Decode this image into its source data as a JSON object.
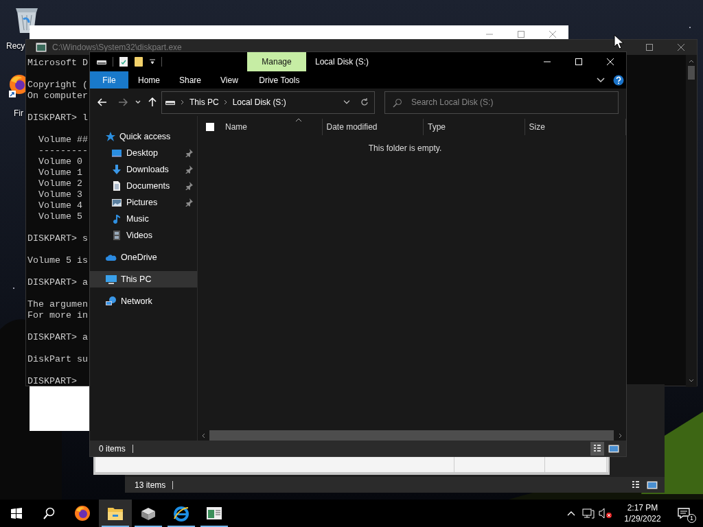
{
  "desktop_icons": [
    {
      "kind": "recycle-bin",
      "label": "Recy"
    },
    {
      "kind": "firefox",
      "label": "Fir"
    }
  ],
  "cmd_window": {
    "title": "C:\\Windows\\System32\\diskpart.exe",
    "blocks": [
      [
        "Microsoft D"
      ],
      [
        "Copyright (",
        "On computer"
      ],
      [
        "DISKPART> l"
      ],
      [
        "  Volume ##",
        "  ---------",
        "  Volume 0",
        "  Volume 1",
        "  Volume 2",
        "  Volume 3",
        "  Volume 4",
        "  Volume 5"
      ],
      [
        "DISKPART> s"
      ],
      [
        "Volume 5 is"
      ],
      [
        "DISKPART> a"
      ],
      [
        "The argumen",
        "For more in"
      ],
      [
        "DISKPART> a"
      ],
      [
        "DiskPart su"
      ],
      [
        "DISKPART>"
      ]
    ]
  },
  "back_explorer": {
    "status": "13 items",
    "views": [
      {
        "kind": "details",
        "selected": false
      },
      {
        "kind": "tiles",
        "selected": false
      }
    ]
  },
  "explorer": {
    "context_tab": "Manage",
    "title": "Local Disk (S:)",
    "ribbon_tabs": [
      {
        "kind": "file",
        "label": "File"
      },
      {
        "kind": "tab",
        "label": "Home"
      },
      {
        "kind": "tab",
        "label": "Share"
      },
      {
        "kind": "tab",
        "label": "View"
      },
      {
        "kind": "context",
        "label": "Drive Tools"
      }
    ],
    "breadcrumb": [
      "This PC",
      "Local Disk (S:)"
    ],
    "search": {
      "placeholder": "Search Local Disk (S:)"
    },
    "nav": [
      {
        "kind": "star",
        "label": "Quick access",
        "selected": false,
        "children": [
          {
            "kind": "desktop",
            "label": "Desktop",
            "pinned": true,
            "selected": false
          },
          {
            "kind": "downloads",
            "label": "Downloads",
            "pinned": true,
            "selected": false
          },
          {
            "kind": "documents",
            "label": "Documents",
            "pinned": true,
            "selected": false
          },
          {
            "kind": "pictures",
            "label": "Pictures",
            "pinned": true,
            "selected": false
          },
          {
            "kind": "music",
            "label": "Music",
            "pinned": false,
            "selected": false
          },
          {
            "kind": "videos",
            "label": "Videos",
            "pinned": false,
            "selected": false
          }
        ]
      },
      {
        "kind": "onedrive",
        "label": "OneDrive",
        "selected": false
      },
      {
        "kind": "thispc",
        "label": "This PC",
        "selected": true
      },
      {
        "kind": "network",
        "label": "Network",
        "selected": false
      }
    ],
    "select_all": {
      "checked": false
    },
    "columns": [
      {
        "label": "Name",
        "sorted": true
      },
      {
        "label": "Date modified",
        "sorted": false
      },
      {
        "label": "Type",
        "sorted": false
      },
      {
        "label": "Size",
        "sorted": false
      }
    ],
    "empty_message": "This folder is empty.",
    "status": "0 items",
    "views": [
      {
        "kind": "details",
        "selected": true
      },
      {
        "kind": "tiles",
        "selected": false
      }
    ]
  },
  "taskbar": {
    "buttons": [
      {
        "kind": "start",
        "running": false,
        "selected": false
      },
      {
        "kind": "search",
        "running": false,
        "selected": false
      },
      {
        "kind": "firefox",
        "running": false,
        "selected": false
      },
      {
        "kind": "explorer",
        "running": true,
        "selected": true
      },
      {
        "kind": "drive-app",
        "running": true,
        "selected": false
      },
      {
        "kind": "ie",
        "running": true,
        "selected": false
      },
      {
        "kind": "window-app",
        "running": true,
        "selected": false
      }
    ],
    "time": "2:17 PM",
    "date": "1/29/2022",
    "notifications": "1"
  }
}
